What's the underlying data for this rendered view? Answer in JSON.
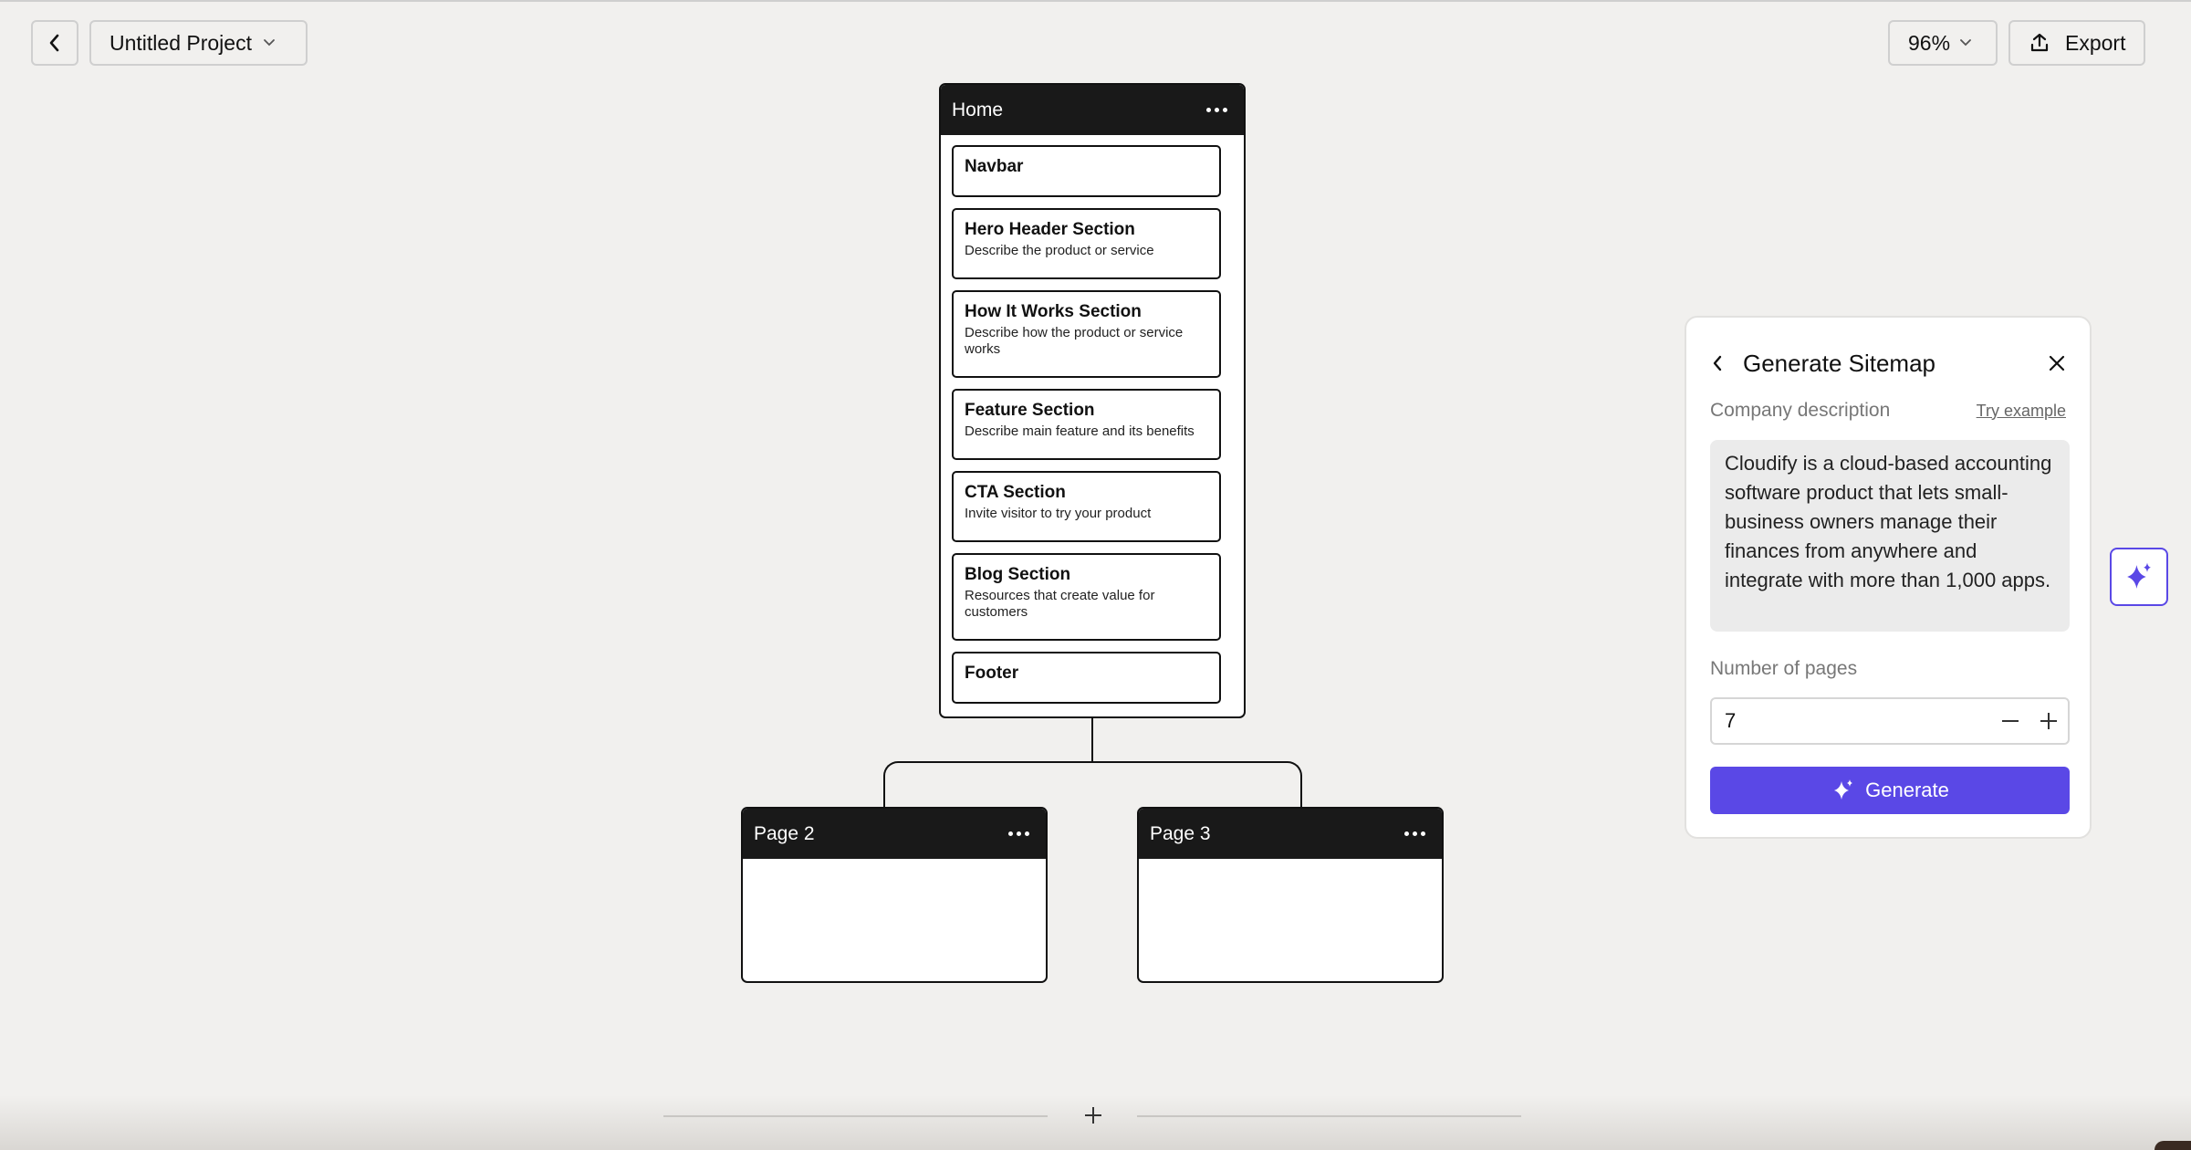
{
  "toolbar": {
    "project_name": "Untitled Project",
    "zoom": "96%",
    "export_label": "Export"
  },
  "home": {
    "title": "Home",
    "sections": [
      {
        "title": "Navbar",
        "desc": ""
      },
      {
        "title": "Hero Header Section",
        "desc": "Describe the product or service"
      },
      {
        "title": "How It Works Section",
        "desc": "Describe how the product or service works"
      },
      {
        "title": "Feature Section",
        "desc": "Describe main feature and its benefits"
      },
      {
        "title": "CTA Section",
        "desc": "Invite visitor to try your product"
      },
      {
        "title": "Blog Section",
        "desc": "Resources that create value for customers"
      },
      {
        "title": "Footer",
        "desc": ""
      }
    ]
  },
  "page2": {
    "title": "Page 2"
  },
  "page3": {
    "title": "Page 3"
  },
  "panel": {
    "title": "Generate Sitemap",
    "description_label": "Company description",
    "try_example": "Try example",
    "description": "Cloudify is a cloud-based accounting software product that lets small-business owners manage their finances from anywhere and integrate with more than 1,000 apps.",
    "pages_label": "Number of pages",
    "pages_value": "7",
    "generate_label": "Generate"
  },
  "colors": {
    "accent": "#5a48e6",
    "node_header": "#191919",
    "canvas": "#f1f0ee"
  }
}
